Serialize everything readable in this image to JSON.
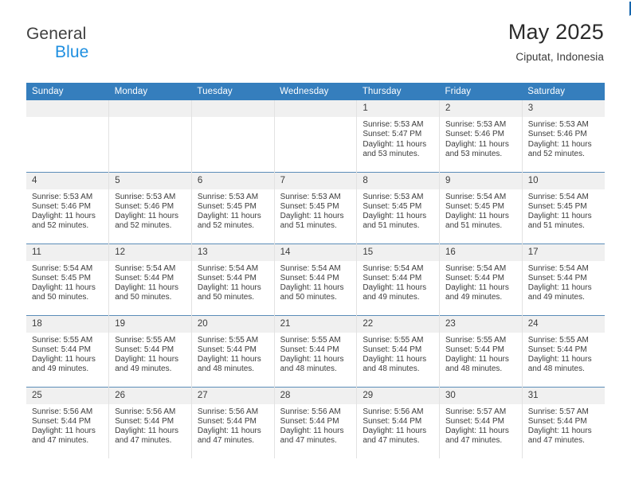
{
  "brand": {
    "line1": "General",
    "line2": "Blue",
    "flag_icon": "triangle-flag-icon",
    "accent_color": "#1666ad",
    "secondary_color": "#1f8fe0"
  },
  "header": {
    "month_title": "May 2025",
    "location": "Ciputat, Indonesia"
  },
  "theme": {
    "header_row_background": "#357ebd",
    "header_row_text": "#ffffff",
    "daynum_background": "#f0f0f0",
    "row_separator": "#5b8db8",
    "cell_divider": "#e2e2e2",
    "body_text": "#3c3c3c"
  },
  "weekday_headers": [
    "Sunday",
    "Monday",
    "Tuesday",
    "Wednesday",
    "Thursday",
    "Friday",
    "Saturday"
  ],
  "labels": {
    "sunrise_prefix": "Sunrise:",
    "sunset_prefix": "Sunset:",
    "daylight_prefix": "Daylight:"
  },
  "weeks": [
    [
      {
        "day": "",
        "empty": true
      },
      {
        "day": "",
        "empty": true
      },
      {
        "day": "",
        "empty": true
      },
      {
        "day": "",
        "empty": true
      },
      {
        "day": "1",
        "sunrise": "Sunrise: 5:53 AM",
        "sunset": "Sunset: 5:47 PM",
        "daylight_line1": "Daylight: 11 hours",
        "daylight_line2": "and 53 minutes."
      },
      {
        "day": "2",
        "sunrise": "Sunrise: 5:53 AM",
        "sunset": "Sunset: 5:46 PM",
        "daylight_line1": "Daylight: 11 hours",
        "daylight_line2": "and 53 minutes."
      },
      {
        "day": "3",
        "sunrise": "Sunrise: 5:53 AM",
        "sunset": "Sunset: 5:46 PM",
        "daylight_line1": "Daylight: 11 hours",
        "daylight_line2": "and 52 minutes."
      }
    ],
    [
      {
        "day": "4",
        "sunrise": "Sunrise: 5:53 AM",
        "sunset": "Sunset: 5:46 PM",
        "daylight_line1": "Daylight: 11 hours",
        "daylight_line2": "and 52 minutes."
      },
      {
        "day": "5",
        "sunrise": "Sunrise: 5:53 AM",
        "sunset": "Sunset: 5:46 PM",
        "daylight_line1": "Daylight: 11 hours",
        "daylight_line2": "and 52 minutes."
      },
      {
        "day": "6",
        "sunrise": "Sunrise: 5:53 AM",
        "sunset": "Sunset: 5:45 PM",
        "daylight_line1": "Daylight: 11 hours",
        "daylight_line2": "and 52 minutes."
      },
      {
        "day": "7",
        "sunrise": "Sunrise: 5:53 AM",
        "sunset": "Sunset: 5:45 PM",
        "daylight_line1": "Daylight: 11 hours",
        "daylight_line2": "and 51 minutes."
      },
      {
        "day": "8",
        "sunrise": "Sunrise: 5:53 AM",
        "sunset": "Sunset: 5:45 PM",
        "daylight_line1": "Daylight: 11 hours",
        "daylight_line2": "and 51 minutes."
      },
      {
        "day": "9",
        "sunrise": "Sunrise: 5:54 AM",
        "sunset": "Sunset: 5:45 PM",
        "daylight_line1": "Daylight: 11 hours",
        "daylight_line2": "and 51 minutes."
      },
      {
        "day": "10",
        "sunrise": "Sunrise: 5:54 AM",
        "sunset": "Sunset: 5:45 PM",
        "daylight_line1": "Daylight: 11 hours",
        "daylight_line2": "and 51 minutes."
      }
    ],
    [
      {
        "day": "11",
        "sunrise": "Sunrise: 5:54 AM",
        "sunset": "Sunset: 5:45 PM",
        "daylight_line1": "Daylight: 11 hours",
        "daylight_line2": "and 50 minutes."
      },
      {
        "day": "12",
        "sunrise": "Sunrise: 5:54 AM",
        "sunset": "Sunset: 5:44 PM",
        "daylight_line1": "Daylight: 11 hours",
        "daylight_line2": "and 50 minutes."
      },
      {
        "day": "13",
        "sunrise": "Sunrise: 5:54 AM",
        "sunset": "Sunset: 5:44 PM",
        "daylight_line1": "Daylight: 11 hours",
        "daylight_line2": "and 50 minutes."
      },
      {
        "day": "14",
        "sunrise": "Sunrise: 5:54 AM",
        "sunset": "Sunset: 5:44 PM",
        "daylight_line1": "Daylight: 11 hours",
        "daylight_line2": "and 50 minutes."
      },
      {
        "day": "15",
        "sunrise": "Sunrise: 5:54 AM",
        "sunset": "Sunset: 5:44 PM",
        "daylight_line1": "Daylight: 11 hours",
        "daylight_line2": "and 49 minutes."
      },
      {
        "day": "16",
        "sunrise": "Sunrise: 5:54 AM",
        "sunset": "Sunset: 5:44 PM",
        "daylight_line1": "Daylight: 11 hours",
        "daylight_line2": "and 49 minutes."
      },
      {
        "day": "17",
        "sunrise": "Sunrise: 5:54 AM",
        "sunset": "Sunset: 5:44 PM",
        "daylight_line1": "Daylight: 11 hours",
        "daylight_line2": "and 49 minutes."
      }
    ],
    [
      {
        "day": "18",
        "sunrise": "Sunrise: 5:55 AM",
        "sunset": "Sunset: 5:44 PM",
        "daylight_line1": "Daylight: 11 hours",
        "daylight_line2": "and 49 minutes."
      },
      {
        "day": "19",
        "sunrise": "Sunrise: 5:55 AM",
        "sunset": "Sunset: 5:44 PM",
        "daylight_line1": "Daylight: 11 hours",
        "daylight_line2": "and 49 minutes."
      },
      {
        "day": "20",
        "sunrise": "Sunrise: 5:55 AM",
        "sunset": "Sunset: 5:44 PM",
        "daylight_line1": "Daylight: 11 hours",
        "daylight_line2": "and 48 minutes."
      },
      {
        "day": "21",
        "sunrise": "Sunrise: 5:55 AM",
        "sunset": "Sunset: 5:44 PM",
        "daylight_line1": "Daylight: 11 hours",
        "daylight_line2": "and 48 minutes."
      },
      {
        "day": "22",
        "sunrise": "Sunrise: 5:55 AM",
        "sunset": "Sunset: 5:44 PM",
        "daylight_line1": "Daylight: 11 hours",
        "daylight_line2": "and 48 minutes."
      },
      {
        "day": "23",
        "sunrise": "Sunrise: 5:55 AM",
        "sunset": "Sunset: 5:44 PM",
        "daylight_line1": "Daylight: 11 hours",
        "daylight_line2": "and 48 minutes."
      },
      {
        "day": "24",
        "sunrise": "Sunrise: 5:55 AM",
        "sunset": "Sunset: 5:44 PM",
        "daylight_line1": "Daylight: 11 hours",
        "daylight_line2": "and 48 minutes."
      }
    ],
    [
      {
        "day": "25",
        "sunrise": "Sunrise: 5:56 AM",
        "sunset": "Sunset: 5:44 PM",
        "daylight_line1": "Daylight: 11 hours",
        "daylight_line2": "and 47 minutes."
      },
      {
        "day": "26",
        "sunrise": "Sunrise: 5:56 AM",
        "sunset": "Sunset: 5:44 PM",
        "daylight_line1": "Daylight: 11 hours",
        "daylight_line2": "and 47 minutes."
      },
      {
        "day": "27",
        "sunrise": "Sunrise: 5:56 AM",
        "sunset": "Sunset: 5:44 PM",
        "daylight_line1": "Daylight: 11 hours",
        "daylight_line2": "and 47 minutes."
      },
      {
        "day": "28",
        "sunrise": "Sunrise: 5:56 AM",
        "sunset": "Sunset: 5:44 PM",
        "daylight_line1": "Daylight: 11 hours",
        "daylight_line2": "and 47 minutes."
      },
      {
        "day": "29",
        "sunrise": "Sunrise: 5:56 AM",
        "sunset": "Sunset: 5:44 PM",
        "daylight_line1": "Daylight: 11 hours",
        "daylight_line2": "and 47 minutes."
      },
      {
        "day": "30",
        "sunrise": "Sunrise: 5:57 AM",
        "sunset": "Sunset: 5:44 PM",
        "daylight_line1": "Daylight: 11 hours",
        "daylight_line2": "and 47 minutes."
      },
      {
        "day": "31",
        "sunrise": "Sunrise: 5:57 AM",
        "sunset": "Sunset: 5:44 PM",
        "daylight_line1": "Daylight: 11 hours",
        "daylight_line2": "and 47 minutes."
      }
    ]
  ]
}
